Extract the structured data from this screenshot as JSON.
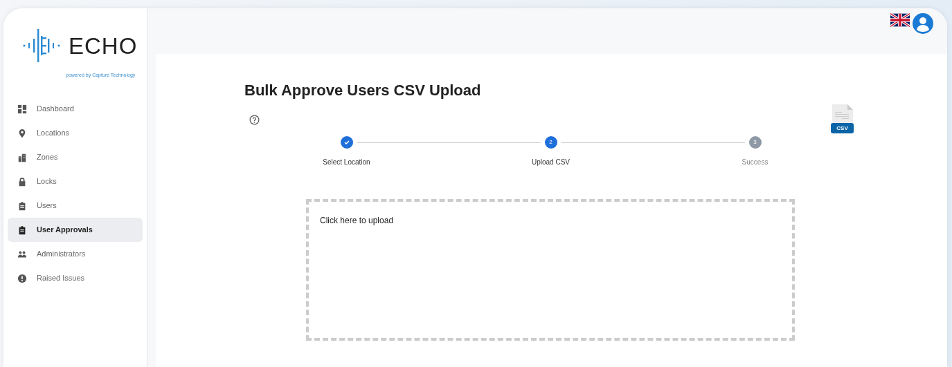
{
  "brand": {
    "name": "ECHO",
    "tagline": "powered by Capture Technology"
  },
  "sidebar": {
    "items": [
      {
        "label": "Dashboard",
        "selected": false
      },
      {
        "label": "Locations",
        "selected": false
      },
      {
        "label": "Zones",
        "selected": false
      },
      {
        "label": "Locks",
        "selected": false
      },
      {
        "label": "Users",
        "selected": false
      },
      {
        "label": "User Approvals",
        "selected": true
      },
      {
        "label": "Administrators",
        "selected": false
      },
      {
        "label": "Raised Issues",
        "selected": false
      }
    ]
  },
  "page": {
    "title": "Bulk Approve Users CSV Upload"
  },
  "steps": [
    {
      "label": "Select Location",
      "kind": "done"
    },
    {
      "label": "Upload CSV",
      "kind": "active",
      "number": "2"
    },
    {
      "label": "Success",
      "kind": "pending",
      "number": "3"
    }
  ],
  "file_icon": {
    "label": "CSV"
  },
  "dropzone": {
    "text": "Click here to upload"
  }
}
